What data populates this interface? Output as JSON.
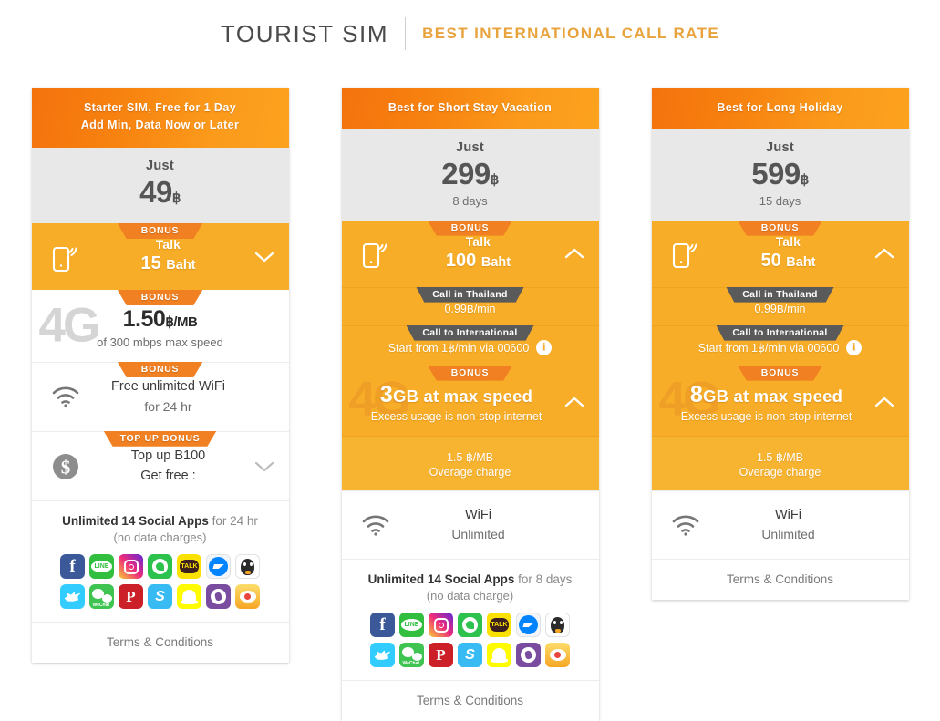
{
  "header": {
    "brand": "TOURIST SIM",
    "tagline": "BEST INTERNATIONAL CALL RATE",
    "divider_icon": "vertical-divider"
  },
  "colors": {
    "header_orange_start": "#f4720d",
    "header_orange_end": "#fca21f",
    "amber": "#f7ad27",
    "amber_sub": "#f7b431",
    "ribbon_orange": "#f08021",
    "tag_gray": "#5a5a5a",
    "price_panel": "#e8e8e8",
    "tagline_orange": "#e8a33d"
  },
  "labels": {
    "bonus": "BONUS",
    "top_up_bonus": "TOP UP BONUS",
    "terms": "Terms & Conditions",
    "just": "Just",
    "talk": "Talk",
    "call_in_thailand": "Call in Thailand",
    "call_to_international": "Call to International",
    "info_icon_char": "i"
  },
  "social_apps": [
    {
      "name": "facebook",
      "label": "f",
      "bg": "#3b5998"
    },
    {
      "name": "line",
      "label": "LINE",
      "bg": "#32bf3f"
    },
    {
      "name": "instagram",
      "label": "",
      "bg": "#cf3a8e"
    },
    {
      "name": "whatsapp",
      "label": "",
      "bg": "#2dc24e"
    },
    {
      "name": "kakaotalk",
      "label": "TALK",
      "bg": "#fae100"
    },
    {
      "name": "messenger",
      "label": "",
      "bg": "#f2f6fb"
    },
    {
      "name": "qq",
      "label": "",
      "bg": "#ffffff"
    },
    {
      "name": "twitter",
      "label": "",
      "bg": "#32ccfe"
    },
    {
      "name": "wechat",
      "label": "WeChat",
      "bg": "#3fc351"
    },
    {
      "name": "pinterest",
      "label": "P",
      "bg": "#cb2027"
    },
    {
      "name": "skype",
      "label": "S",
      "bg": "#37bbf2"
    },
    {
      "name": "snapchat",
      "label": "",
      "bg": "#fffc00"
    },
    {
      "name": "viber",
      "label": "",
      "bg": "#7a4ca0"
    },
    {
      "name": "weibo",
      "label": "",
      "bg": "#fbc02d"
    }
  ],
  "cards": [
    {
      "id": "starter-sim",
      "head_line1": "Starter SIM, Free for 1 Day",
      "head_line2": "Add Min, Data Now or Later",
      "price": {
        "just": "Just",
        "amount": "49",
        "currency": "฿",
        "days": ""
      },
      "talk": {
        "bonus": "BONUS",
        "label": "Talk",
        "value": "15",
        "unit": "Baht",
        "chevron": "chevron-down",
        "expanded": false
      },
      "data": {
        "bonus": "BONUS",
        "watermark": "4G",
        "style": "white",
        "price": "1.50",
        "price_unit": "฿/MB",
        "sub": "of 300 mbps max speed"
      },
      "wifi": {
        "bonus": "BONUS",
        "title": "Free unlimited WiFi",
        "sub": "for 24 hr",
        "icon": "wifi-icon"
      },
      "topup": {
        "bonus": "TOP UP BONUS",
        "title": "Top up B100",
        "sub": "Get free :",
        "icon": "dollar-coin-icon",
        "chevron": "chevron-down"
      },
      "social": {
        "head_strong": "Unlimited 14 Social Apps",
        "head_muted": "for 24 hr",
        "sub": "(no data charges)"
      },
      "terms": "Terms & Conditions"
    },
    {
      "id": "short-stay",
      "head_line1": "Best for Short Stay Vacation",
      "head_line2": "",
      "price": {
        "just": "Just",
        "amount": "299",
        "currency": "฿",
        "days": "8 days"
      },
      "talk": {
        "bonus": "BONUS",
        "label": "Talk",
        "value": "100",
        "unit": "Baht",
        "chevron": "chevron-up",
        "expanded": true,
        "thailand_tag": "Call in Thailand",
        "thailand_rate": "0.99฿/min",
        "intl_tag": "Call to International",
        "intl_rate": "Start from 1฿/min via 00600"
      },
      "data": {
        "bonus": "BONUS",
        "watermark": "4G",
        "style": "amber",
        "amount": "3",
        "main": "GB at max speed",
        "sub": "Excess usage is non-stop internet",
        "chevron": "chevron-up",
        "overage_rate": "1.5 ฿/MB",
        "overage_label": "Overage charge"
      },
      "wifi": {
        "title": "WiFi",
        "sub": "Unlimited",
        "icon": "wifi-icon"
      },
      "social": {
        "head_strong": "Unlimited 14 Social Apps",
        "head_muted": "for 8 days",
        "sub": "(no data charge)"
      },
      "terms": "Terms & Conditions"
    },
    {
      "id": "long-holiday",
      "head_line1": "Best for Long Holiday",
      "head_line2": "",
      "price": {
        "just": "Just",
        "amount": "599",
        "currency": "฿",
        "days": "15 days"
      },
      "talk": {
        "bonus": "BONUS",
        "label": "Talk",
        "value": "50",
        "unit": "Baht",
        "chevron": "chevron-up",
        "expanded": true,
        "thailand_tag": "Call in Thailand",
        "thailand_rate": "0.99฿/min",
        "intl_tag": "Call to International",
        "intl_rate": "Start from 1฿/min via 00600"
      },
      "data": {
        "bonus": "BONUS",
        "watermark": "4G",
        "style": "amber",
        "amount": "8",
        "main": "GB at max speed",
        "sub": "Excess usage is non-stop internet",
        "chevron": "chevron-up",
        "overage_rate": "1.5 ฿/MB",
        "overage_label": "Overage charge"
      },
      "wifi": {
        "title": "WiFi",
        "sub": "Unlimited",
        "icon": "wifi-icon"
      },
      "terms": "Terms & Conditions"
    }
  ]
}
